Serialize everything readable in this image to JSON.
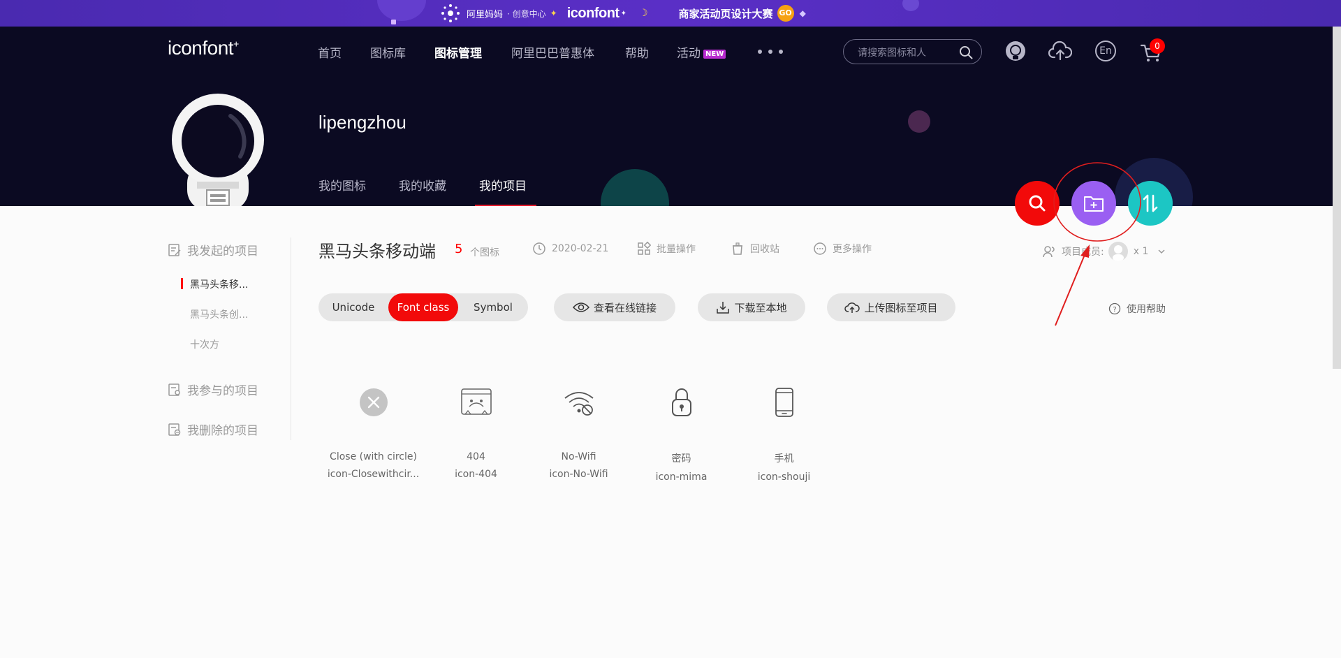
{
  "promo": {
    "brand": "阿里妈妈",
    "sub": "· 创意中心",
    "logo": "iconfont",
    "contest": "商家活动页设计大赛",
    "go": "GO"
  },
  "nav": {
    "logo": "iconfont",
    "items": [
      {
        "label": "首页"
      },
      {
        "label": "图标库"
      },
      {
        "label": "图标管理"
      },
      {
        "label": "阿里巴巴普惠体"
      },
      {
        "label": "帮助"
      },
      {
        "label": "活动"
      }
    ],
    "new_badge": "NEW",
    "search_placeholder": "请搜索图标和人",
    "lang": "En",
    "cart_count": "0"
  },
  "profile": {
    "username": "lipengzhou",
    "tabs": [
      {
        "label": "我的图标"
      },
      {
        "label": "我的收藏"
      },
      {
        "label": "我的项目"
      }
    ],
    "active_tab": "我的项目"
  },
  "fabs": {
    "search_color": "#f20a0a",
    "add_project_color": "#9a5ff2",
    "sort_color": "#1cc6c4"
  },
  "sidebar": {
    "groups": [
      {
        "label": "我发起的项目"
      },
      {
        "label": "我参与的项目"
      },
      {
        "label": "我删除的项目"
      }
    ],
    "items": [
      {
        "label": "黑马头条移..."
      },
      {
        "label": "黑马头条创..."
      },
      {
        "label": "十次方"
      }
    ],
    "active_item": "黑马头条移..."
  },
  "project": {
    "title": "黑马头条移动端",
    "icon_count": "5",
    "icon_count_label": "个图标",
    "date": "2020-02-21",
    "batch": "批量操作",
    "trash": "回收站",
    "more": "更多操作",
    "members_label": "项目成员:",
    "members_count": "x 1"
  },
  "toolbar": {
    "tabs": [
      {
        "label": "Unicode"
      },
      {
        "label": "Font class"
      },
      {
        "label": "Symbol"
      }
    ],
    "active_tab": "Font class",
    "view_link": "查看在线链接",
    "download": "下载至本地",
    "upload": "上传图标至项目",
    "help": "使用帮助"
  },
  "icons": [
    {
      "name": "Close (with circle)",
      "class": "icon-Closewithcir...",
      "icon": "close-circle-icon"
    },
    {
      "name": "404",
      "class": "icon-404",
      "icon": "404-page-icon"
    },
    {
      "name": "No-Wifi",
      "class": "icon-No-Wifi",
      "icon": "no-wifi-icon"
    },
    {
      "name": "密码",
      "class": "icon-mima",
      "icon": "lock-icon"
    },
    {
      "name": "手机",
      "class": "icon-shouji",
      "icon": "phone-icon"
    }
  ],
  "colors": {
    "nav_bg": "#0b0a22",
    "promo_bg": "#5a2fc6",
    "accent_red": "#f20a0a",
    "annotation": "#e01e1e"
  }
}
